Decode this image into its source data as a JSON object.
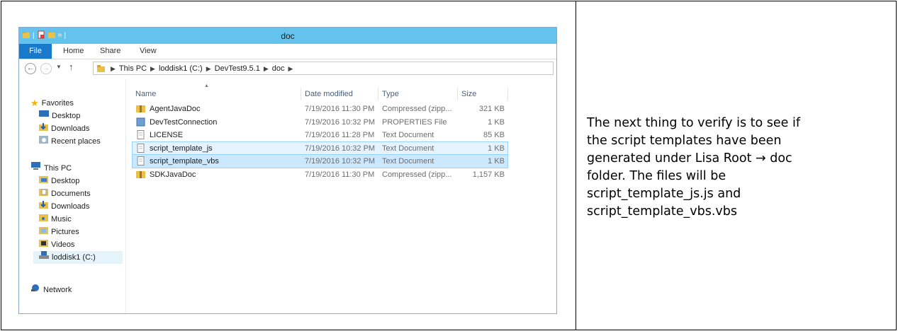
{
  "window": {
    "title": "doc",
    "ribbon_tabs": [
      "File",
      "Home",
      "Share",
      "View"
    ],
    "address_crumbs": [
      "This PC",
      "loddisk1 (C:)",
      "DevTest9.5.1",
      "doc"
    ]
  },
  "nav": {
    "favorites_header": "Favorites",
    "favorites": [
      "Desktop",
      "Downloads",
      "Recent places"
    ],
    "thispc_header": "This PC",
    "thispc": [
      "Desktop",
      "Documents",
      "Downloads",
      "Music",
      "Pictures",
      "Videos",
      "loddisk1 (C:)"
    ],
    "network": "Network"
  },
  "columns": {
    "name": "Name",
    "date": "Date modified",
    "type": "Type",
    "size": "Size"
  },
  "files": [
    {
      "name": "AgentJavaDoc",
      "date": "7/19/2016 11:30 PM",
      "type": "Compressed (zipp...",
      "size": "321 KB",
      "icon": "zip-folder-icon"
    },
    {
      "name": "DevTestConnection",
      "date": "7/19/2016 10:32 PM",
      "type": "PROPERTIES File",
      "size": "1 KB",
      "icon": "properties-file-icon"
    },
    {
      "name": "LICENSE",
      "date": "7/19/2016 11:28 PM",
      "type": "Text Document",
      "size": "85 KB",
      "icon": "text-file-icon"
    },
    {
      "name": "script_template_js",
      "date": "7/19/2016 10:32 PM",
      "type": "Text Document",
      "size": "1 KB",
      "icon": "text-file-icon"
    },
    {
      "name": "script_template_vbs",
      "date": "7/19/2016 10:32 PM",
      "type": "Text Document",
      "size": "1 KB",
      "icon": "text-file-icon"
    },
    {
      "name": "SDKJavaDoc",
      "date": "7/19/2016 11:30 PM",
      "type": "Compressed (zipp...",
      "size": "1,157 KB",
      "icon": "zip-folder-icon"
    }
  ],
  "caption": {
    "lines": [
      "The next thing to verify is to see if",
      "the script templates have been",
      "generated under Lisa Root → doc",
      "folder. The files will be",
      "script_template_js.js and",
      "script_template_vbs.vbs"
    ]
  },
  "colors": {
    "titlebar": "#63c3ec",
    "file_tab": "#1979ca",
    "selection": "#cce8ff"
  }
}
